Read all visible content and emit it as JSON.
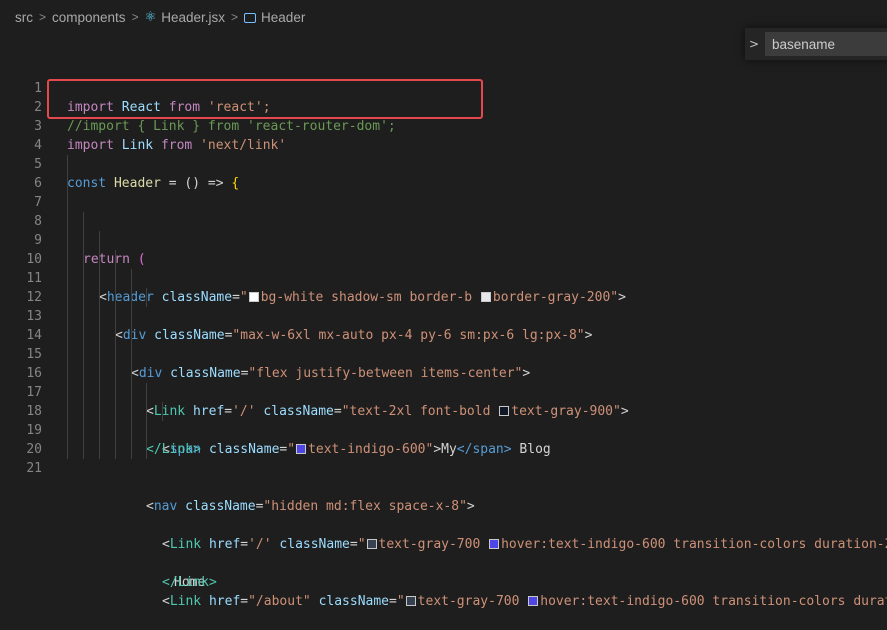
{
  "breadcrumb": {
    "items": [
      "src",
      "components",
      "Header.jsx",
      "Header"
    ],
    "separator": ">"
  },
  "find": {
    "value": "basename",
    "toggle_glyph": ">"
  },
  "editor": {
    "line_numbers": [
      "1",
      "2",
      "3",
      "4",
      "5",
      "6",
      "7",
      "8",
      "9",
      "10",
      "11",
      "12",
      "13",
      "14",
      "15",
      "16",
      "17",
      "18",
      "19",
      "20",
      "21"
    ],
    "tokens": {
      "import": "import",
      "from": "from",
      "react_id": "React",
      "react_str": "'react';",
      "l2_comment": "//import { Link } from 'react-router-dom';",
      "link_id": "Link",
      "next_str": "'next/link'",
      "const": "const",
      "header_fn": "Header",
      "arrow_head": " = () => ",
      "brace_open": "{",
      "return": "return",
      "paren_open": "(",
      "lt": "<",
      "gt": ">",
      "eq": "=",
      "q": "\"",
      "header_tag": "header",
      "div_tag": "div",
      "span_tag": "span",
      "nav_tag": "nav",
      "link_tag": "Link",
      "className": "className",
      "href": "href",
      "l9_a": "bg-white shadow-sm border-b ",
      "l9_b": "border-gray-200",
      "l10_str": "\"max-w-6xl mx-auto px-4 py-6 sm:px-6 lg:px-8\"",
      "l11_str": "\"flex justify-between items-center\"",
      "root_href": "'/'",
      "l12_a": "text-2xl font-bold ",
      "l12_b": "text-gray-900",
      "l13_a": "text-indigo-600",
      "my": "My",
      "span_close": "</span>",
      "blog": " Blog",
      "link_close": "</Link>",
      "l17_str": "\"hidden md:flex space-x-8\"",
      "l18_a": "text-gray-700 ",
      "l18_b": "hover:text-indigo-600 transition-colors duration-2",
      "home": "Home",
      "about_href": "\"/about\"",
      "l21_b": "hover:text-indigo-600 transition-colors durat"
    }
  },
  "colors": {
    "swatch_white": "#ffffff",
    "swatch_gray200": "#e5e7eb",
    "swatch_gray900": "#111827",
    "swatch_indigo600": "#4f46e5",
    "swatch_gray700": "#374151",
    "highlight_border": "#e5484d"
  }
}
